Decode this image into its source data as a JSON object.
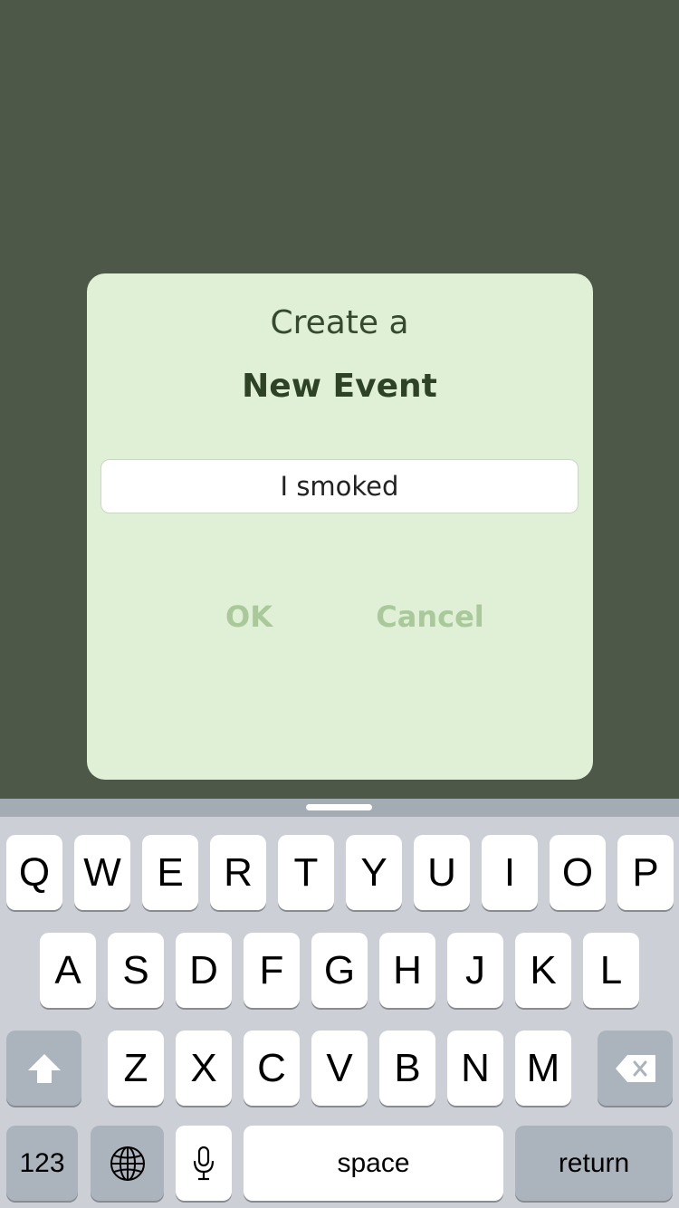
{
  "dialog": {
    "title": "Create a",
    "heading": "New Event",
    "input_value": "I smoked",
    "ok_label": "OK",
    "cancel_label": "Cancel"
  },
  "keyboard": {
    "row1": [
      "Q",
      "W",
      "E",
      "R",
      "T",
      "Y",
      "U",
      "I",
      "O",
      "P"
    ],
    "row2": [
      "A",
      "S",
      "D",
      "F",
      "G",
      "H",
      "J",
      "K",
      "L"
    ],
    "row3": [
      "Z",
      "X",
      "C",
      "V",
      "B",
      "N",
      "M"
    ],
    "numbers_label": "123",
    "space_label": "space",
    "return_label": "return",
    "icons": {
      "shift": "shift-icon",
      "delete": "backspace-icon",
      "globe": "globe-icon",
      "mic": "microphone-icon"
    }
  },
  "colors": {
    "backdrop": "#4e5849",
    "dialog_bg": "#dff0d6",
    "button_text": "#a9c99a",
    "keyboard_bg": "#ccd0d6"
  }
}
